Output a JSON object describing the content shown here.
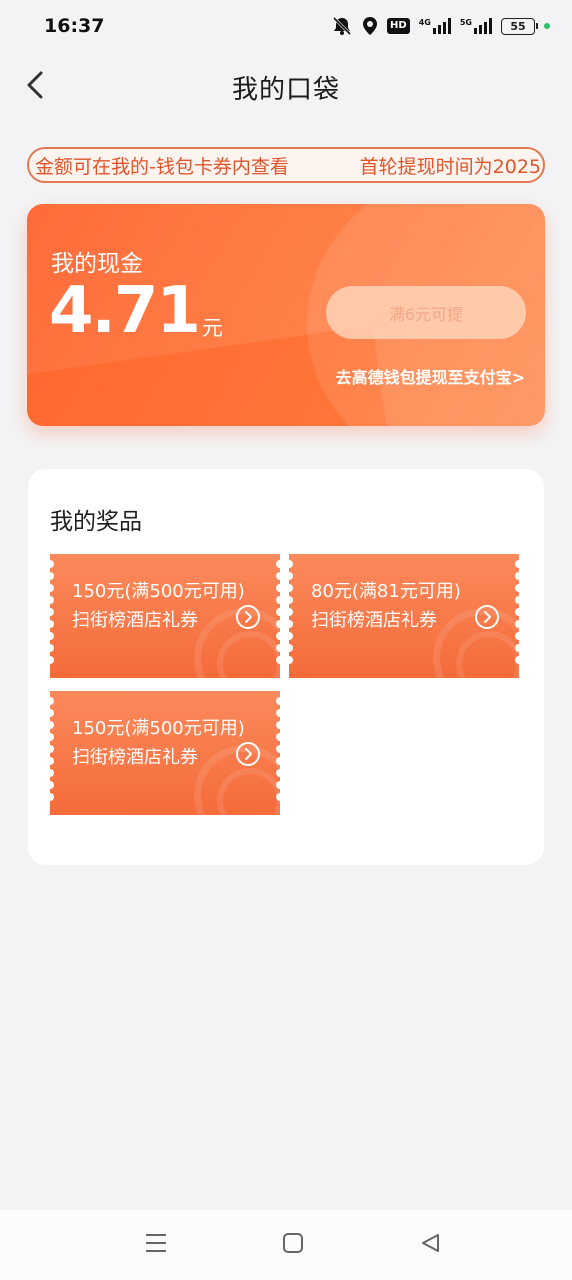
{
  "status_bar": {
    "time": "16:37",
    "hd_label": "HD",
    "net1_label": "4G",
    "net2_label": "5G",
    "battery": "55",
    "icons": [
      "bell-muted-icon",
      "location-icon",
      "signal-icon",
      "signal-icon",
      "battery-icon"
    ]
  },
  "header": {
    "title": "我的口袋",
    "back_icon": "chevron-left-icon"
  },
  "notice": {
    "text_left": "金额可在我的-钱包卡券内查看",
    "text_right": "首轮提现时间为2025"
  },
  "cash_card": {
    "label": "我的现金",
    "amount": "4.71",
    "unit": "元",
    "withdraw_button": "满6元可提",
    "wallet_link": "去高德钱包提现至支付宝>"
  },
  "prizes": {
    "title": "我的奖品",
    "items": [
      {
        "title": "150元(满500元可用)",
        "subtitle": "扫街榜酒店礼券"
      },
      {
        "title": "80元(满81元可用)",
        "subtitle": "扫街榜酒店礼券"
      },
      {
        "title": "150元(满500元可用)",
        "subtitle": "扫街榜酒店礼券"
      }
    ]
  },
  "colors": {
    "accent": "#ff6b3a",
    "notice_border": "#e07a52",
    "notice_text": "#e0552a",
    "background": "#f3f3f5"
  },
  "system_nav": {
    "icons": [
      "menu-icon",
      "home-square-icon",
      "back-triangle-icon"
    ]
  }
}
